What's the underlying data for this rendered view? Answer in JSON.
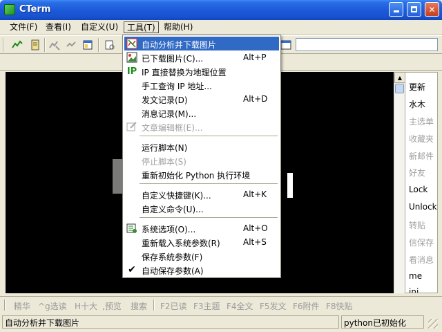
{
  "window": {
    "title": "CTerm"
  },
  "menubar": [
    {
      "label": "文件(F)"
    },
    {
      "label": "查看(I)"
    },
    {
      "label": "自定义(U)"
    },
    {
      "label": "工具(T)"
    },
    {
      "label": "帮助(H)"
    }
  ],
  "tools_menu": {
    "items": [
      {
        "label": "自动分析并下载图片",
        "shortcut": "",
        "icon": "auto-download-icon"
      },
      {
        "label": "已下载图片(C)...",
        "shortcut": "Alt+P",
        "icon": "picture-icon"
      },
      {
        "label": "IP 直接替换为地理位置",
        "shortcut": "",
        "icon": "ip-icon",
        "icon_text": "IP"
      },
      {
        "label": "手工查询 IP 地址...",
        "shortcut": "",
        "icon": ""
      },
      {
        "label": "发文记录(D)",
        "shortcut": "Alt+D",
        "icon": ""
      },
      {
        "label": "消息记录(M)...",
        "shortcut": "",
        "icon": ""
      },
      {
        "label": "文章编辑框(E)...",
        "shortcut": "",
        "icon": "edit-icon"
      },
      {
        "label": "运行脚本(N)",
        "shortcut": "",
        "icon": ""
      },
      {
        "label": "停止脚本(S)",
        "shortcut": "",
        "icon": ""
      },
      {
        "label": "重新初始化 Python 执行环境",
        "shortcut": "",
        "icon": ""
      },
      {
        "label": "自定义快捷键(K)...",
        "shortcut": "Alt+K",
        "icon": ""
      },
      {
        "label": "自定义命令(U)...",
        "shortcut": "",
        "icon": ""
      },
      {
        "label": "系统选项(O)...",
        "shortcut": "Alt+O",
        "icon": "settings-icon"
      },
      {
        "label": "重新载入系统参数(R)",
        "shortcut": "Alt+S",
        "icon": ""
      },
      {
        "label": "保存系统参数(F)",
        "shortcut": "",
        "icon": ""
      },
      {
        "label": "自动保存参数(A)",
        "shortcut": "",
        "icon": "checkmark-icon"
      }
    ]
  },
  "right_panel": [
    {
      "label": "更新",
      "enabled": true
    },
    {
      "label": "水木",
      "enabled": true
    },
    {
      "label": "主选单",
      "enabled": false
    },
    {
      "label": "收藏夹",
      "enabled": false
    },
    {
      "label": "新邮件",
      "enabled": false
    },
    {
      "label": "好友",
      "enabled": false
    },
    {
      "label": "Lock",
      "enabled": true
    },
    {
      "label": "Unlock",
      "enabled": true
    },
    {
      "label": "转贴",
      "enabled": false
    },
    {
      "label": "信保存",
      "enabled": false
    },
    {
      "label": "看消息",
      "enabled": false
    },
    {
      "label": "me",
      "enabled": true
    },
    {
      "label": "ini",
      "enabled": true
    }
  ],
  "function_bar": [
    {
      "label": "精华"
    },
    {
      "label": "^g选读"
    },
    {
      "label": "H十大"
    },
    {
      "label": ",预览"
    },
    {
      "label": "搜索"
    },
    {
      "label": "F2已读"
    },
    {
      "label": "F3主题"
    },
    {
      "label": "F4全文"
    },
    {
      "label": "F5发文"
    },
    {
      "label": "F6附件"
    },
    {
      "label": "F8快贴"
    }
  ],
  "statusbar": {
    "message": "自动分析并下载图片",
    "python_status": "python已初始化"
  },
  "colors": {
    "highlight": "#316ac5",
    "titlebar": "#1d5ad9",
    "terminal_bg": "#000000",
    "disabled_text": "#a0a0a0"
  }
}
